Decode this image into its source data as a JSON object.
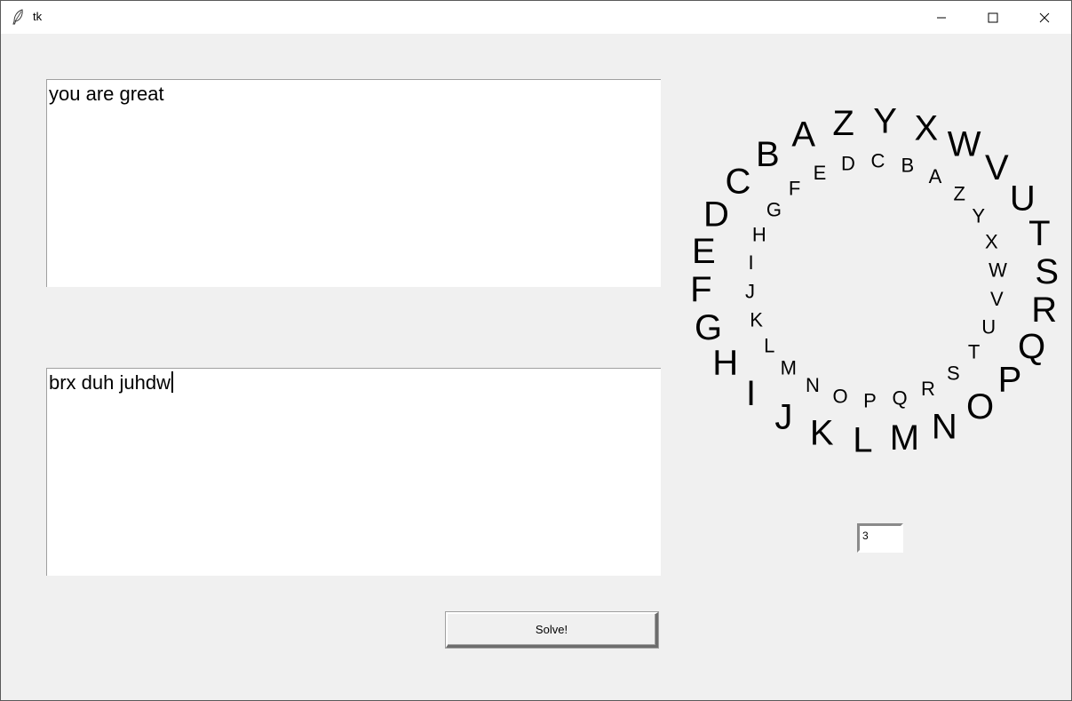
{
  "window": {
    "title": "tk"
  },
  "input_text": "you are great",
  "output_text": "brx duh juhdw",
  "solve_button": "Solve!",
  "shift_value": "3",
  "wheel": {
    "outer_letters": [
      "A",
      "B",
      "C",
      "D",
      "E",
      "F",
      "G",
      "H",
      "I",
      "J",
      "K",
      "L",
      "M",
      "N",
      "O",
      "P",
      "Q",
      "R",
      "S",
      "T",
      "U",
      "V",
      "W",
      "X",
      "Y",
      "Z"
    ],
    "inner_letters": [
      "D",
      "E",
      "F",
      "G",
      "H",
      "I",
      "J",
      "K",
      "L",
      "M",
      "N",
      "O",
      "P",
      "Q",
      "R",
      "S",
      "T",
      "U",
      "V",
      "W",
      "X",
      "Y",
      "Z",
      "A",
      "B",
      "C"
    ]
  },
  "icons": {
    "app": "feather-icon",
    "minimize": "minimize-icon",
    "maximize": "maximize-icon",
    "close": "close-icon"
  }
}
